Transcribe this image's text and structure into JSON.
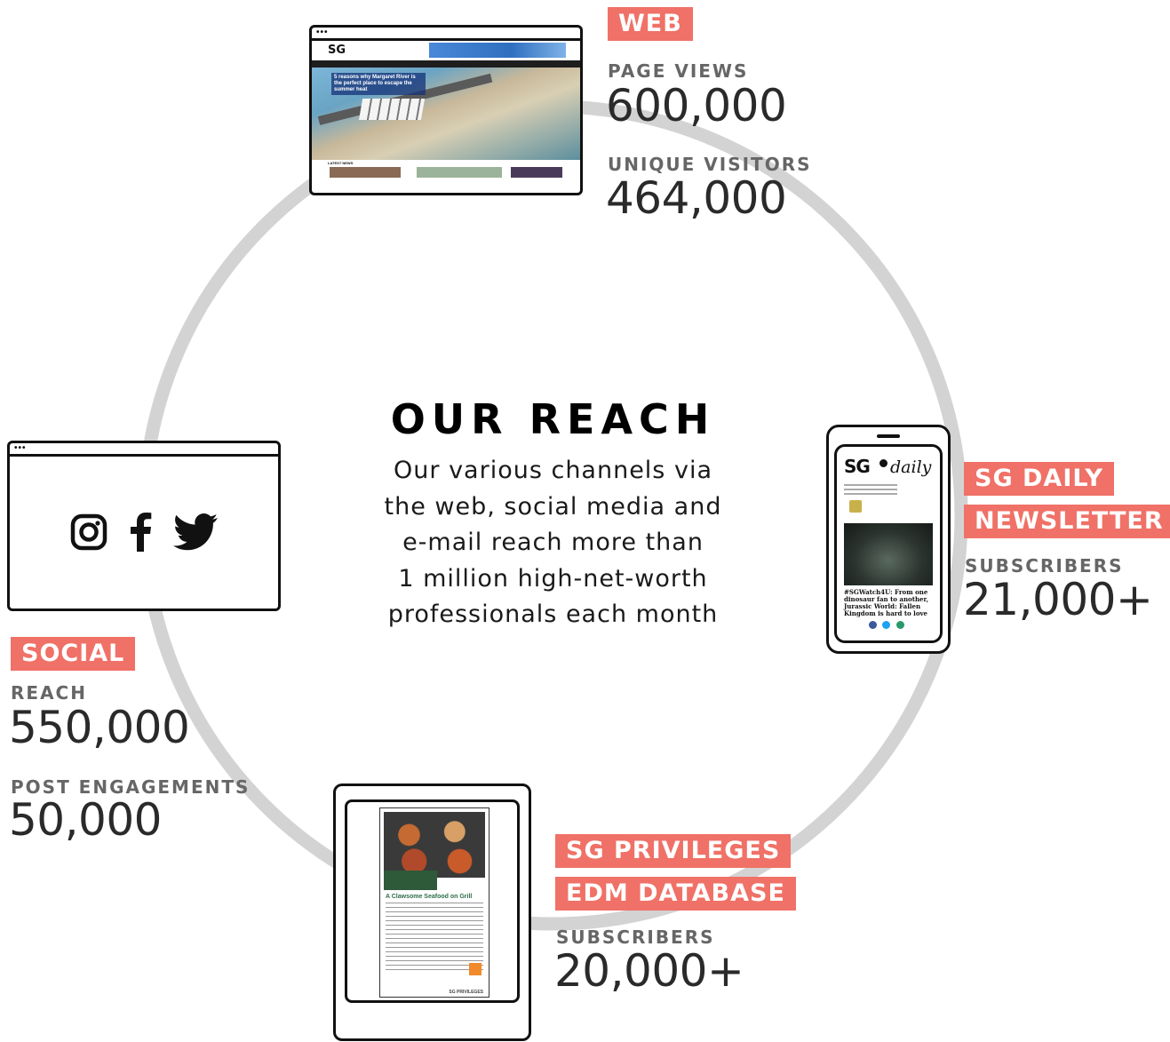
{
  "center": {
    "title": "OUR REACH",
    "description_lines": [
      "Our various channels via",
      "the web, social media and",
      "e-mail reach more than",
      "1 million high-net-worth",
      "professionals each month"
    ]
  },
  "web": {
    "tag": "WEB",
    "stats": [
      {
        "label": "PAGE VIEWS",
        "value": "600,000"
      },
      {
        "label": "UNIQUE VISITORS",
        "value": "464,000"
      }
    ],
    "screenshot": {
      "logo": "SG",
      "headline": "5 reasons why Margaret River is the perfect place to escape the summer heat",
      "section": "LATEST NEWS"
    }
  },
  "newsletter": {
    "tag_lines": [
      "SG DAILY",
      "NEWSLETTER"
    ],
    "stats": [
      {
        "label": "SUBSCRIBERS",
        "value": "21,000+"
      }
    ],
    "screenshot": {
      "brand_sg": "SG",
      "brand_daily": "daily",
      "caption": "#SGWatch4U: From one dinosaur fan to another, Jurassic World: Fallen Kingdom is hard to love"
    }
  },
  "social": {
    "tag": "SOCIAL",
    "icons": [
      "instagram-icon",
      "facebook-icon",
      "twitter-icon"
    ],
    "stats": [
      {
        "label": "REACH",
        "value": "550,000"
      },
      {
        "label": "POST ENGAGEMENTS",
        "value": "50,000"
      }
    ]
  },
  "edm": {
    "tag_lines": [
      "SG PRIVILEGES",
      "EDM DATABASE"
    ],
    "stats": [
      {
        "label": "SUBSCRIBERS",
        "value": "20,000+"
      }
    ],
    "screenshot": {
      "title": "A Clawsome Seafood on Grill",
      "footer": "SG PRIVILEGES"
    }
  },
  "colors": {
    "accent": "#f07167",
    "ring": "#d3d3d3",
    "label_gray": "#666666",
    "value_gray": "#2a2a2a"
  }
}
